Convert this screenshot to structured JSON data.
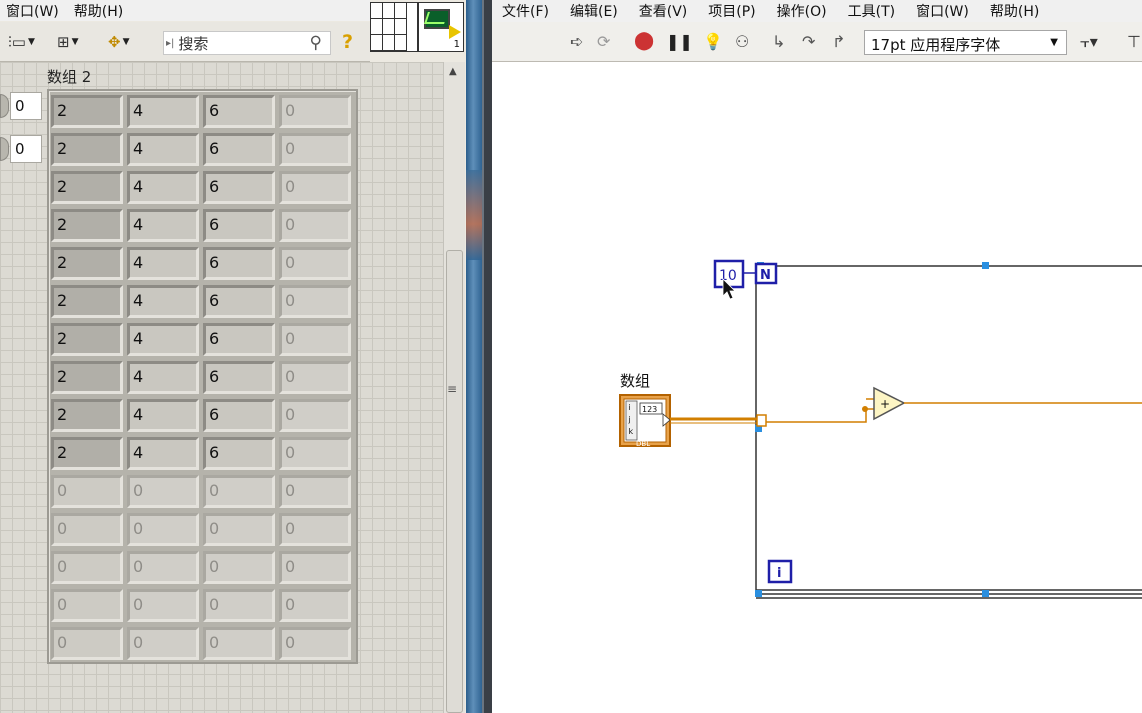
{
  "front_panel": {
    "menu": [
      "窗口(W)",
      "帮助(H)"
    ],
    "toolbar": {
      "search_placeholder": "搜索",
      "icons": [
        "align-objects-icon",
        "distribute-objects-icon",
        "reorder-icon",
        "search-icon",
        "help-icon"
      ]
    },
    "connector_pane_number": "1",
    "array": {
      "label": "数组 2",
      "index_values": [
        "0",
        "0"
      ],
      "rows": [
        [
          "2",
          "4",
          "6",
          "0"
        ],
        [
          "2",
          "4",
          "6",
          "0"
        ],
        [
          "2",
          "4",
          "6",
          "0"
        ],
        [
          "2",
          "4",
          "6",
          "0"
        ],
        [
          "2",
          "4",
          "6",
          "0"
        ],
        [
          "2",
          "4",
          "6",
          "0"
        ],
        [
          "2",
          "4",
          "6",
          "0"
        ],
        [
          "2",
          "4",
          "6",
          "0"
        ],
        [
          "2",
          "4",
          "6",
          "0"
        ],
        [
          "2",
          "4",
          "6",
          "0"
        ],
        [
          "0",
          "0",
          "0",
          "0"
        ],
        [
          "0",
          "0",
          "0",
          "0"
        ],
        [
          "0",
          "0",
          "0",
          "0"
        ],
        [
          "0",
          "0",
          "0",
          "0"
        ],
        [
          "0",
          "0",
          "0",
          "0"
        ]
      ],
      "filled_rows": 10,
      "filled_cols": 3
    }
  },
  "block_diagram": {
    "menu": [
      "文件(F)",
      "编辑(E)",
      "查看(V)",
      "项目(P)",
      "操作(O)",
      "工具(T)",
      "窗口(W)",
      "帮助(H)"
    ],
    "toolbar": {
      "font_selector": "17pt 应用程序字体",
      "icons": [
        "run-icon",
        "run-continuously-icon",
        "abort-icon",
        "pause-icon",
        "highlight-execution-icon",
        "retain-wire-values-icon",
        "step-into-icon",
        "step-over-icon",
        "step-out-icon",
        "align-icon"
      ]
    },
    "for_loop": {
      "count_constant": "10",
      "count_terminal": "N",
      "iteration_terminal": "i"
    },
    "array_control": {
      "label": "数组",
      "type_label": "123",
      "dbl_label": "DBL",
      "index_letters": [
        "i",
        "j",
        "k"
      ]
    },
    "add_node_symbol": "+",
    "colors": {
      "wire_orange": "#d27f00",
      "terminal_blue": "#1f1fa8",
      "handle_blue": "#2a8fe0",
      "loop_border": "#333333"
    }
  }
}
